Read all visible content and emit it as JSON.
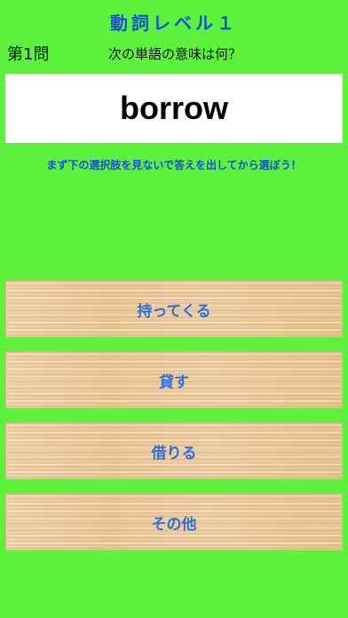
{
  "header": {
    "title": "動詞レベル１",
    "question_number": "第1問",
    "prompt": "次の単語の意味は何？"
  },
  "question": {
    "word": "borrow",
    "hint": "まず下の選択肢を見ないで答えを出してから選ぼう！"
  },
  "choices": [
    {
      "label": "持ってくる"
    },
    {
      "label": "貸す"
    },
    {
      "label": "借りる"
    },
    {
      "label": "その他"
    }
  ],
  "colors": {
    "background": "#5cf23b",
    "title": "#1a4fd6",
    "choice_text": "#2f6fd9"
  }
}
